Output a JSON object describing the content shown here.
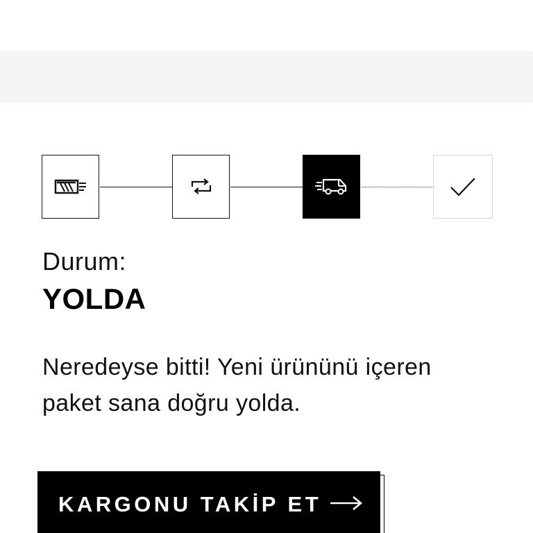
{
  "status": {
    "label": "Durum:",
    "value": "YOLDA"
  },
  "message": {
    "line1": "Neredeyse bitti! Yeni ürününü içeren",
    "line2": "paket sana doğru yolda."
  },
  "tracker": {
    "steps": [
      {
        "icon": "order-placed-icon",
        "state": "done"
      },
      {
        "icon": "processing-exchange-icon",
        "state": "done"
      },
      {
        "icon": "delivery-truck-icon",
        "state": "active"
      },
      {
        "icon": "checkmark-icon",
        "state": "pending"
      }
    ]
  },
  "cta": {
    "label": "KARGONU TAKİP ET",
    "icon": "arrow-right-icon"
  },
  "colors": {
    "band": "#f6f5f3",
    "active": "#000000",
    "pending_border": "#d6d6d6"
  }
}
